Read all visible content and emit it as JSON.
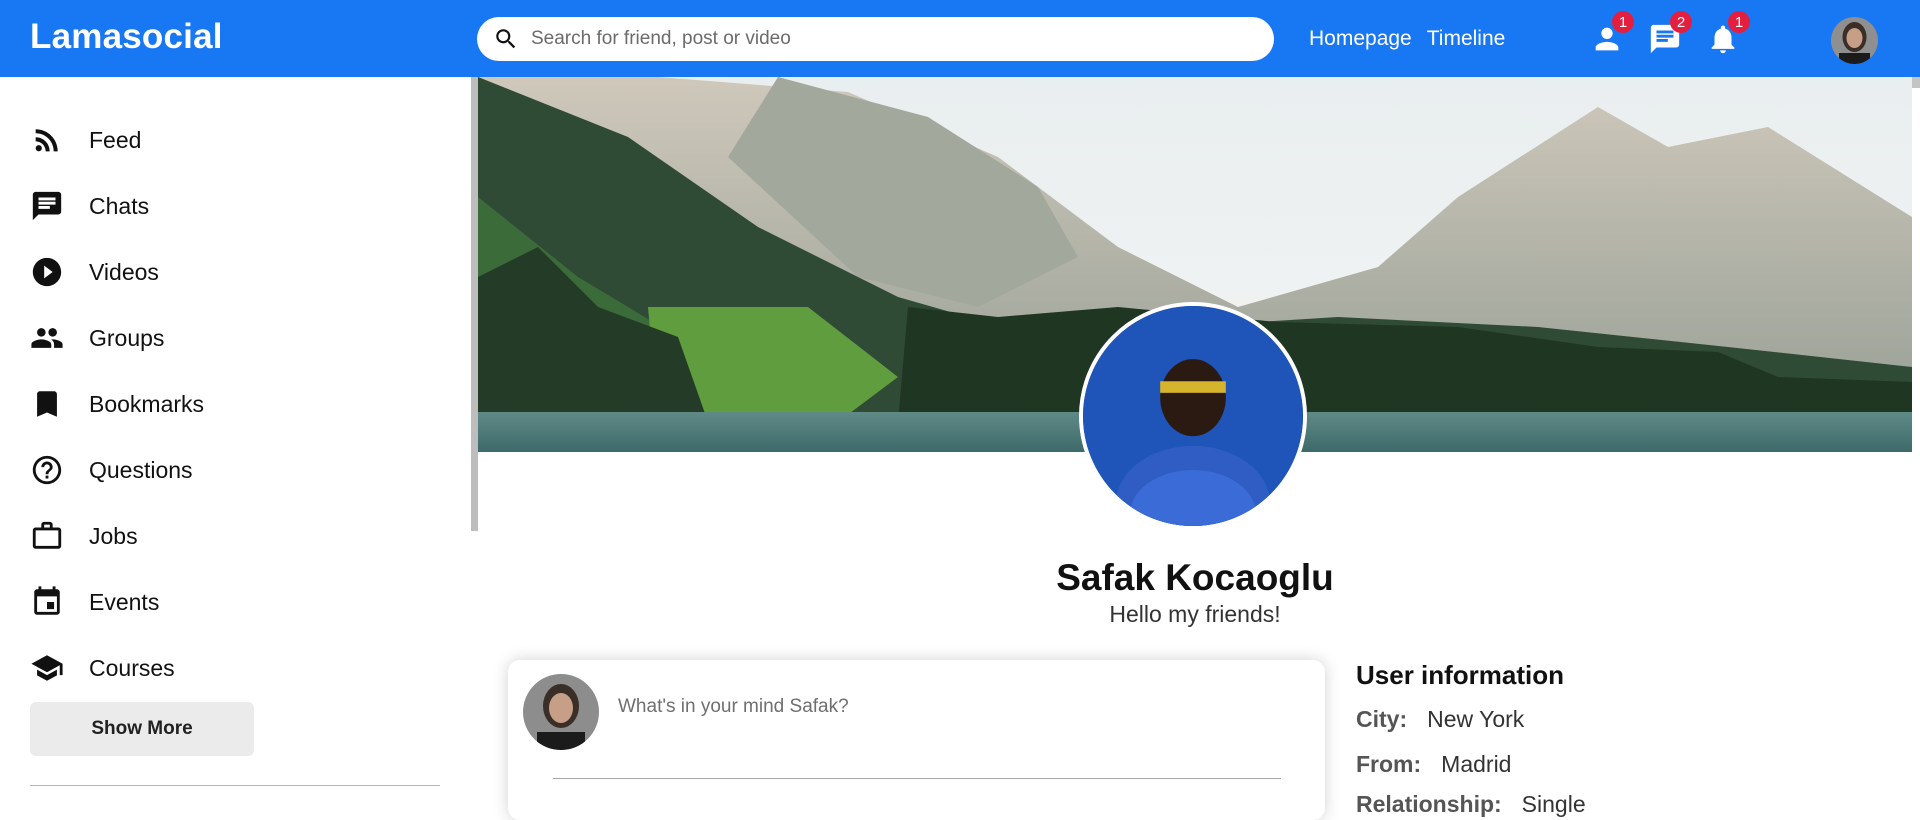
{
  "topbar": {
    "logo": "Lamasocial",
    "search_placeholder": "Search for friend, post or video",
    "links": [
      "Homepage",
      "Timeline"
    ],
    "icons": [
      {
        "icon": "person-icon",
        "badge": "1"
      },
      {
        "icon": "chat-icon",
        "badge": "2"
      },
      {
        "icon": "notifications-icon",
        "badge": "1"
      }
    ],
    "accent": "#1877f2",
    "badge_color": "#e41e3f"
  },
  "sidebar": {
    "items": [
      {
        "label": "Feed",
        "icon": "rss-feed-icon"
      },
      {
        "label": "Chats",
        "icon": "chat-icon"
      },
      {
        "label": "Videos",
        "icon": "play-circle-icon"
      },
      {
        "label": "Groups",
        "icon": "group-icon"
      },
      {
        "label": "Bookmarks",
        "icon": "bookmark-icon"
      },
      {
        "label": "Questions",
        "icon": "help-outline-icon"
      },
      {
        "label": "Jobs",
        "icon": "work-outline-icon"
      },
      {
        "label": "Events",
        "icon": "event-icon"
      },
      {
        "label": "Courses",
        "icon": "school-icon"
      }
    ],
    "show_more": "Show More"
  },
  "profile": {
    "name": "Safak Kocaoglu",
    "desc": "Hello my friends!"
  },
  "share": {
    "placeholder": "What's in your mind Safak?"
  },
  "user_info": {
    "title": "User information",
    "rows": [
      {
        "key": "City:",
        "value": "New York"
      },
      {
        "key": "From:",
        "value": "Madrid"
      },
      {
        "key": "Relationship:",
        "value": "Single"
      }
    ]
  }
}
